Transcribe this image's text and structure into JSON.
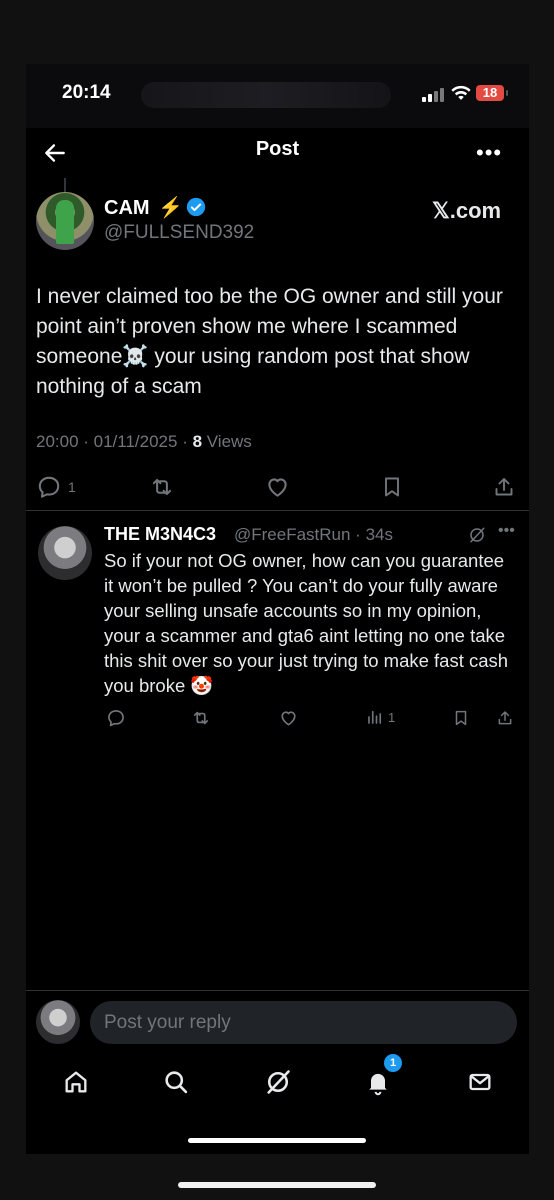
{
  "status_bar": {
    "time": "20:14",
    "battery": "18"
  },
  "header": {
    "title": "Post"
  },
  "post": {
    "author_name": "CAM",
    "author_emoji": "⚡",
    "author_handle": "@FULLSEND392",
    "source": "𝕏.com",
    "text": "I never claimed too be the OG owner and still your point ain’t proven show me where I scammed someone☠️ your using random post that show nothing of a scam",
    "timestamp": "20:00 · 01/11/2025 · ",
    "views_count": "8",
    "views_label": " Views",
    "reply_count": "1"
  },
  "reply": {
    "author_name": "THE M3N4C3",
    "handle_time": "@FreeFastRun · 34s",
    "text": "So if your not OG owner, how can you guarantee it won’t be pulled ? You can’t do your fully aware your selling unsafe accounts so in my opinion, your a scammer and gta6 aint letting no one take this shit over so your just trying to make fast cash you broke 🤡",
    "views_count": "1"
  },
  "composer": {
    "placeholder": "Post your reply"
  },
  "nav": {
    "notification_count": "1"
  },
  "colors": {
    "accent": "#1d9bf0",
    "muted": "#71767b",
    "text": "#e7e9ea",
    "background": "#000000"
  }
}
